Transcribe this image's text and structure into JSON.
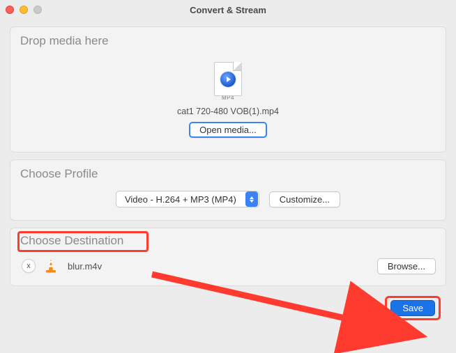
{
  "window": {
    "title": "Convert & Stream"
  },
  "drop": {
    "title": "Drop media here",
    "file_type_badge": "MP4",
    "file_name": "cat1 720-480 VOB(1).mp4",
    "open_media_label": "Open media..."
  },
  "profile": {
    "title": "Choose Profile",
    "selected": "Video - H.264 + MP3 (MP4)",
    "customize_label": "Customize..."
  },
  "destination": {
    "title": "Choose Destination",
    "clear_label": "x",
    "file_name": "blur.m4v",
    "browse_label": "Browse..."
  },
  "footer": {
    "save_label": "Save"
  }
}
